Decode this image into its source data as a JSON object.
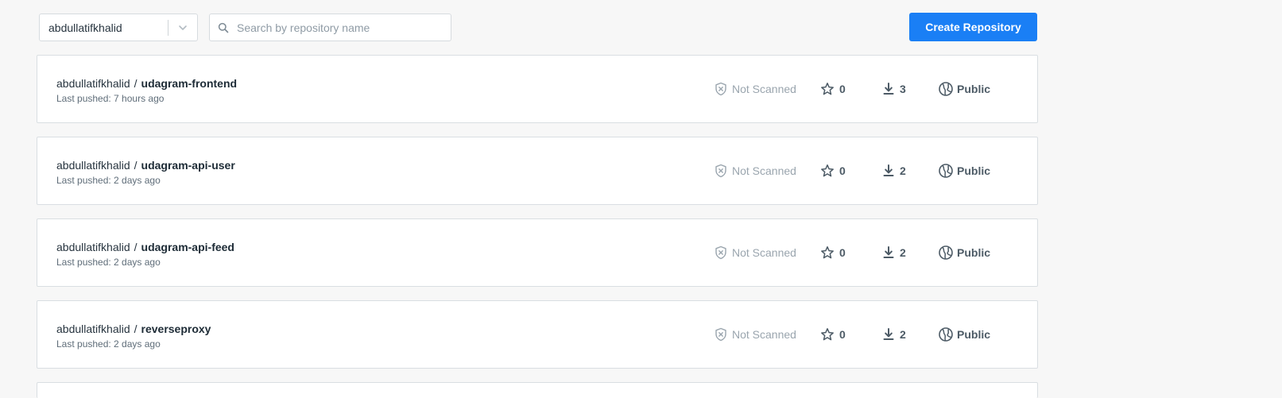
{
  "toolbar": {
    "namespace_value": "abdullatifkhalid",
    "search_placeholder": "Search by repository name",
    "create_label": "Create Repository"
  },
  "colors": {
    "primary": "#1a7ff5",
    "background": "#f7f7f7",
    "not_scanned": "#9aa5ae"
  },
  "icons": {
    "dropdown": "chevron-down-icon",
    "search": "search-icon",
    "scan": "shield-x-icon",
    "stars": "star-icon",
    "pulls": "download-icon",
    "visibility": "globe-icon"
  },
  "repos": [
    {
      "namespace": "abdullatifkhalid",
      "separator": "/",
      "name": "udagram-frontend",
      "pushed": "Last pushed: 7 hours ago",
      "scan": "Not Scanned",
      "stars": "0",
      "pulls": "3",
      "visibility": "Public"
    },
    {
      "namespace": "abdullatifkhalid",
      "separator": "/",
      "name": "udagram-api-user",
      "pushed": "Last pushed: 2 days ago",
      "scan": "Not Scanned",
      "stars": "0",
      "pulls": "2",
      "visibility": "Public"
    },
    {
      "namespace": "abdullatifkhalid",
      "separator": "/",
      "name": "udagram-api-feed",
      "pushed": "Last pushed: 2 days ago",
      "scan": "Not Scanned",
      "stars": "0",
      "pulls": "2",
      "visibility": "Public"
    },
    {
      "namespace": "abdullatifkhalid",
      "separator": "/",
      "name": "reverseproxy",
      "pushed": "Last pushed: 2 days ago",
      "scan": "Not Scanned",
      "stars": "0",
      "pulls": "2",
      "visibility": "Public"
    }
  ]
}
